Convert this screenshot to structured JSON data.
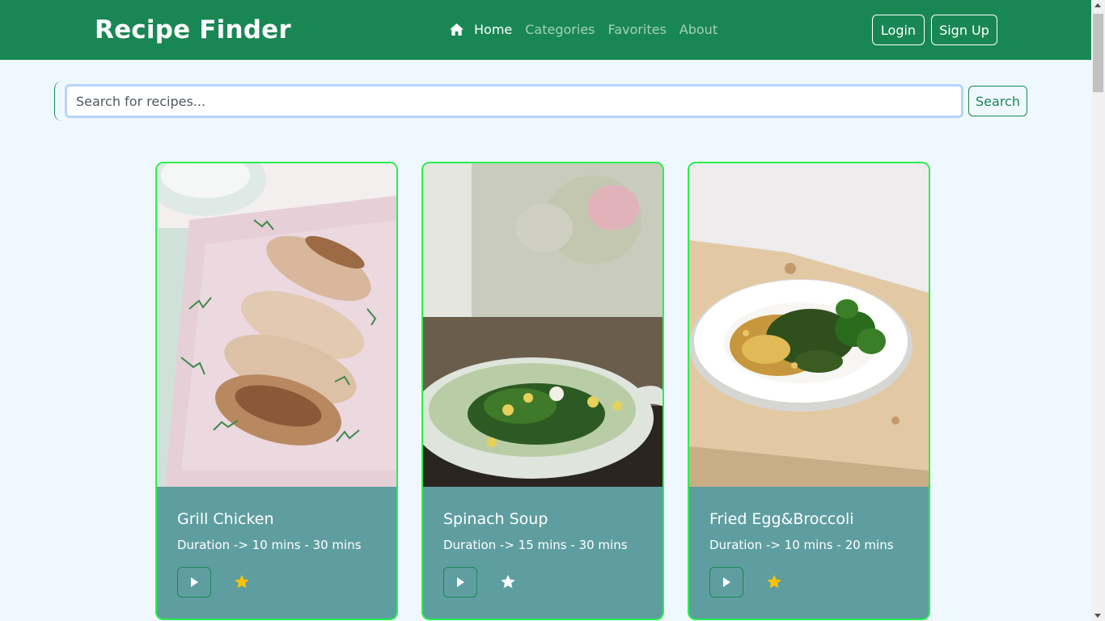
{
  "header": {
    "brand": "Recipe Finder",
    "nav": [
      {
        "label": "Home",
        "icon": "home-icon",
        "active": true
      },
      {
        "label": "Categories",
        "active": false
      },
      {
        "label": "Favorites",
        "active": false
      },
      {
        "label": "About",
        "active": false
      }
    ],
    "login_label": "Login",
    "signup_label": "Sign Up"
  },
  "search": {
    "placeholder": "Search for recipes...",
    "value": "",
    "button_label": "Search"
  },
  "recipes": [
    {
      "title": "Grill Chicken",
      "duration": "Duration -> 10 mins - 30 mins",
      "image": "grilled-chicken-platter",
      "favorite": true
    },
    {
      "title": "Spinach Soup",
      "duration": "Duration -> 15 mins - 30 mins",
      "image": "spinach-soup-bowl",
      "favorite": false
    },
    {
      "title": "Fried Egg&Broccoli",
      "duration": "Duration -> 10 mins - 20 mins",
      "image": "egg-broccoli-plate",
      "favorite": true
    }
  ],
  "colors": {
    "primary": "#198754",
    "background": "#f0f8ff",
    "card_body": "#5f9ea0",
    "card_border": "#2bee51",
    "star_favorite": "#ffc107",
    "star_default": "#ffffff"
  },
  "icons": [
    "home-icon",
    "play-icon",
    "star-icon"
  ]
}
